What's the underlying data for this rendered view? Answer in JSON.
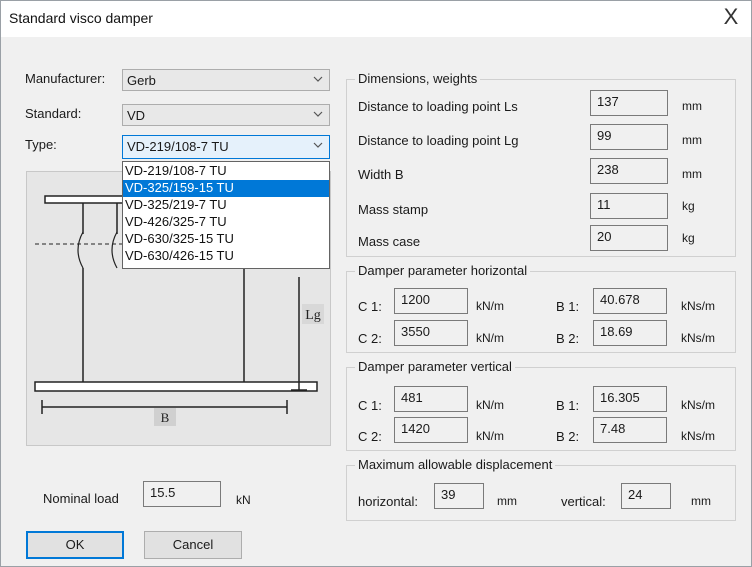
{
  "window": {
    "title": "Standard visco damper",
    "close_glyph": "X"
  },
  "selectors": {
    "manufacturer": {
      "label": "Manufacturer:",
      "value": "Gerb"
    },
    "standard": {
      "label": "Standard:",
      "value": "VD"
    },
    "type": {
      "label": "Type:",
      "value": "VD-219/108-7 TU",
      "options": [
        "VD-219/108-7 TU",
        "VD-325/159-15 TU",
        "VD-325/219-7 TU",
        "VD-426/325-7 TU",
        "VD-630/325-15 TU",
        "VD-630/426-15 TU"
      ],
      "highlighted_index": 1
    }
  },
  "diagram": {
    "label_lg": "Lg",
    "label_b": "B"
  },
  "dimensions": {
    "title": "Dimensions, weights",
    "rows": [
      {
        "label": "Distance to loading point Ls",
        "value": "137",
        "unit": "mm"
      },
      {
        "label": "Distance to loading point Lg",
        "value": "99",
        "unit": "mm"
      },
      {
        "label": "Width B",
        "value": "238",
        "unit": "mm"
      },
      {
        "label": "Mass stamp",
        "value": "11",
        "unit": "kg"
      },
      {
        "label": "Mass case",
        "value": "20",
        "unit": "kg"
      }
    ]
  },
  "horizontal": {
    "title": "Damper parameter horizontal",
    "c1": {
      "label": "C 1:",
      "value": "1200",
      "unit": "kN/m"
    },
    "b1": {
      "label": "B 1:",
      "value": "40.678",
      "unit": "kNs/m"
    },
    "c2": {
      "label": "C 2:",
      "value": "3550",
      "unit": "kN/m"
    },
    "b2": {
      "label": "B 2:",
      "value": "18.69",
      "unit": "kNs/m"
    }
  },
  "vertical": {
    "title": "Damper parameter vertical",
    "c1": {
      "label": "C 1:",
      "value": "481",
      "unit": "kN/m"
    },
    "b1": {
      "label": "B 1:",
      "value": "16.305",
      "unit": "kNs/m"
    },
    "c2": {
      "label": "C 2:",
      "value": "1420",
      "unit": "kN/m"
    },
    "b2": {
      "label": "B 2:",
      "value": "7.48",
      "unit": "kNs/m"
    }
  },
  "displacement": {
    "title": "Maximum allowable displacement",
    "horizontal": {
      "label": "horizontal:",
      "value": "39",
      "unit": "mm"
    },
    "vertical": {
      "label": "vertical:",
      "value": "24",
      "unit": "mm"
    }
  },
  "nominal_load": {
    "label": "Nominal load",
    "value": "15.5",
    "unit": "kN"
  },
  "buttons": {
    "ok": "OK",
    "cancel": "Cancel"
  },
  "colors": {
    "accent": "#0078d7",
    "dialog_bg": "#f0f0f0",
    "diagram_bg": "#e6e6e6"
  }
}
